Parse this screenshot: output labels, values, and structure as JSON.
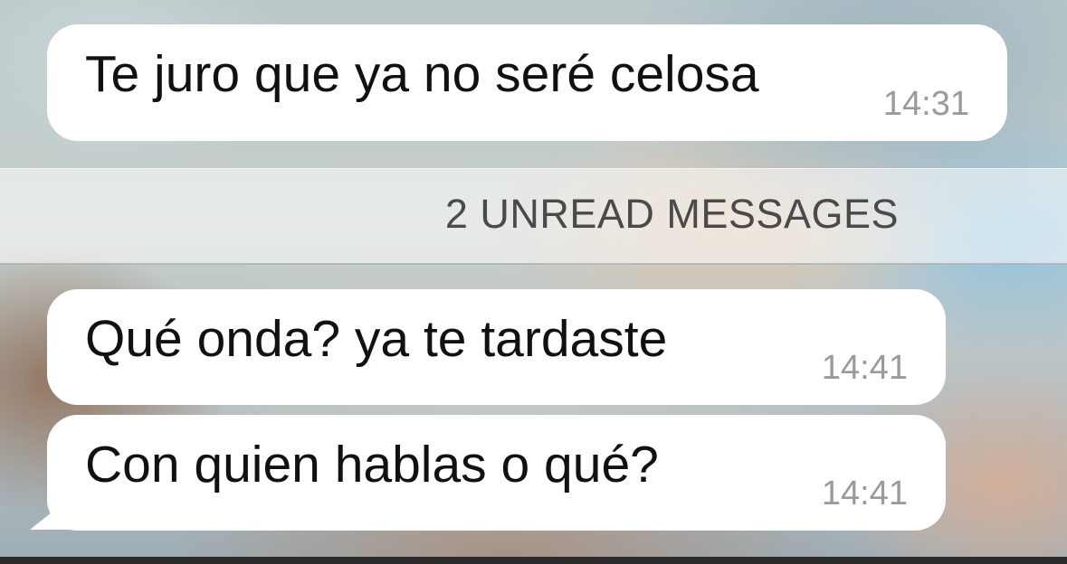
{
  "chat": {
    "messages": [
      {
        "text": "Te juro que ya no seré celosa",
        "time": "14:31"
      },
      {
        "text": "Qué onda? ya te tardaste",
        "time": "14:41"
      },
      {
        "text": "Con quien hablas o qué?",
        "time": "14:41"
      }
    ],
    "unread_divider": "2 UNREAD MESSAGES"
  },
  "colors": {
    "bubble": "#ffffff",
    "text": "#111111",
    "timestamp": "#9a9a9a",
    "divider_text": "#4a4a4a"
  }
}
